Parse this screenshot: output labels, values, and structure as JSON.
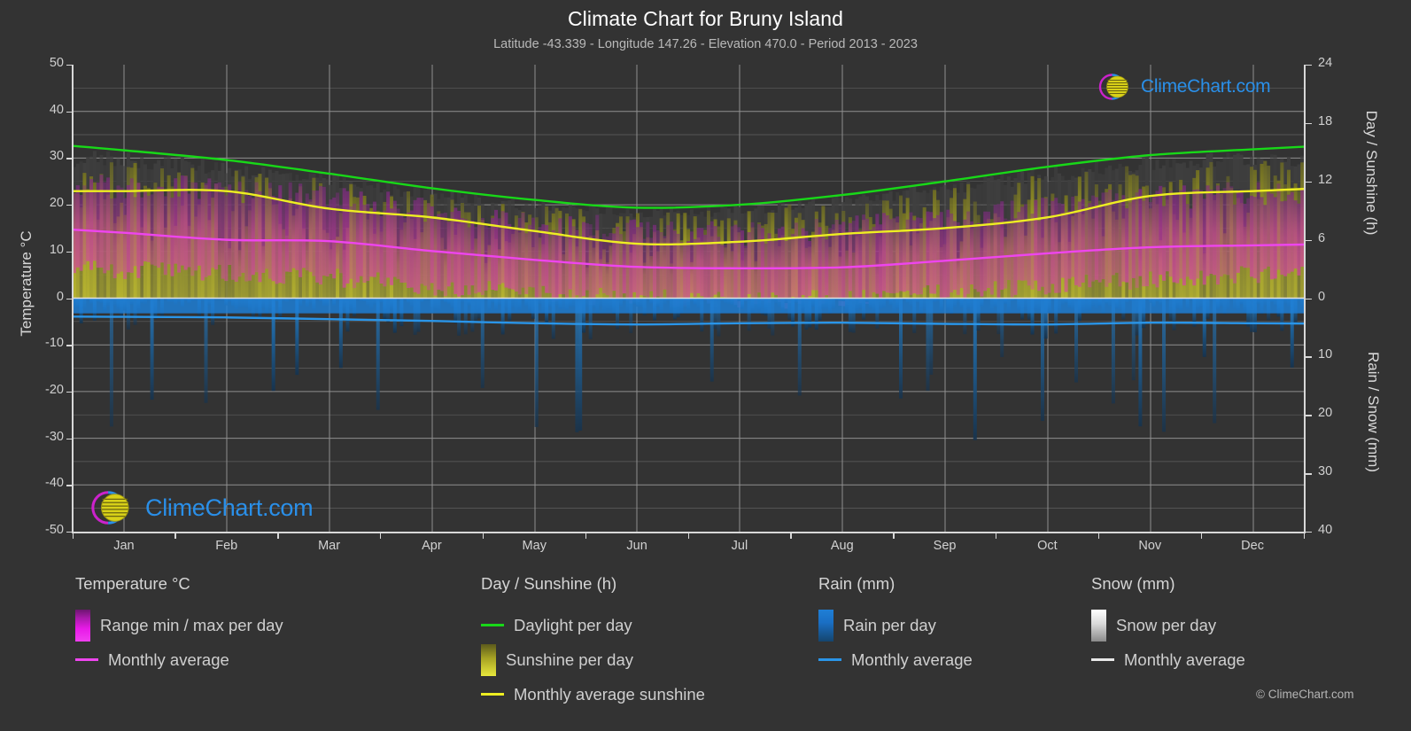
{
  "header": {
    "title": "Climate Chart for Bruny Island",
    "subtitle": "Latitude -43.339 - Longitude 147.26 - Elevation 470.0 - Period 2013 - 2023"
  },
  "branding": {
    "logo_text": "ClimeChart.com",
    "copyright": "© ClimeChart.com",
    "logo_text_color": "#2a8fe8"
  },
  "axes": {
    "left_title": "Temperature °C",
    "right_top_title": "Day / Sunshine (h)",
    "right_bottom_title": "Rain / Snow (mm)",
    "left_ticks": [
      "50",
      "40",
      "30",
      "20",
      "10",
      "0",
      "-10",
      "-20",
      "-30",
      "-40",
      "-50"
    ],
    "right_top_ticks": [
      "24",
      "18",
      "12",
      "6",
      "0"
    ],
    "right_bottom_ticks": [
      "10",
      "20",
      "30",
      "40"
    ]
  },
  "legend": {
    "temperature": {
      "heading": "Temperature °C",
      "items": [
        {
          "label": "Range min / max per day",
          "marker": "gradient-swatch",
          "color": "#e81ae8"
        },
        {
          "label": "Monthly average",
          "marker": "line",
          "color": "#ee45ee"
        }
      ]
    },
    "day_sunshine": {
      "heading": "Day / Sunshine (h)",
      "items": [
        {
          "label": "Daylight per day",
          "marker": "line",
          "color": "#18d818"
        },
        {
          "label": "Sunshine per day",
          "marker": "gradient-swatch",
          "color": "#e8e83c"
        },
        {
          "label": "Monthly average sunshine",
          "marker": "line",
          "color": "#eeee22"
        }
      ]
    },
    "rain": {
      "heading": "Rain (mm)",
      "items": [
        {
          "label": "Rain per day",
          "marker": "gradient-swatch",
          "color": "#1f7fd6"
        },
        {
          "label": "Monthly average",
          "marker": "line",
          "color": "#2a95e8"
        }
      ]
    },
    "snow": {
      "heading": "Snow (mm)",
      "items": [
        {
          "label": "Snow per day",
          "marker": "gradient-swatch",
          "color": "#d8d8d8"
        },
        {
          "label": "Monthly average",
          "marker": "line",
          "color": "#e8e8e8"
        }
      ]
    }
  },
  "chart_data": {
    "type": "line",
    "title": "Climate Chart for Bruny Island",
    "subtitle": "Latitude -43.339 - Longitude 147.26 - Elevation 470.0 - Period 2013 - 2023",
    "xlabel": "",
    "ylabel": "Temperature °C",
    "y2label_top": "Day / Sunshine (h)",
    "y2label_bottom": "Rain / Snow (mm)",
    "ylim": [
      -50,
      50
    ],
    "y2lim_hours": [
      0,
      24
    ],
    "y2lim_mm": [
      0,
      40
    ],
    "grid": true,
    "legend_position": "below",
    "categories": [
      "Jan",
      "Feb",
      "Mar",
      "Apr",
      "May",
      "Jun",
      "Jul",
      "Aug",
      "Sep",
      "Oct",
      "Nov",
      "Dec"
    ],
    "series": [
      {
        "name": "Daylight per day",
        "unit": "h",
        "axis": "right-hours",
        "color": "#18d818",
        "values": [
          15.2,
          14.2,
          12.8,
          11.3,
          10.1,
          9.3,
          9.6,
          10.6,
          12.0,
          13.5,
          14.7,
          15.3
        ]
      },
      {
        "name": "Monthly average sunshine",
        "unit": "h",
        "axis": "right-hours",
        "color": "#eeee22",
        "values": [
          11.0,
          11.0,
          9.2,
          8.3,
          6.9,
          5.6,
          5.8,
          6.6,
          7.2,
          8.3,
          10.5,
          11.0
        ]
      },
      {
        "name": "Temperature monthly average",
        "unit": "°C",
        "axis": "left-temp",
        "color": "#ee45ee",
        "values": [
          14.0,
          12.5,
          12.2,
          10.1,
          8.2,
          6.7,
          6.4,
          6.6,
          8.0,
          9.6,
          10.9,
          11.3
        ]
      },
      {
        "name": "Rain monthly average",
        "unit": "mm",
        "axis": "right-mm",
        "color": "#2a95e8",
        "values": [
          3.2,
          3.3,
          3.6,
          3.9,
          4.3,
          4.5,
          4.3,
          4.2,
          4.4,
          4.5,
          4.2,
          4.3
        ]
      }
    ],
    "daily_bands": [
      {
        "name": "Temperature range min / max per day",
        "axis": "left-temp",
        "color": "#e81ae8",
        "monthly_max": [
          23.0,
          22.5,
          21.0,
          18.0,
          15.5,
          13.5,
          13.0,
          14.0,
          16.0,
          18.5,
          20.5,
          21.5
        ],
        "monthly_min": [
          6.0,
          5.5,
          4.5,
          2.5,
          1.0,
          0.0,
          -0.5,
          0.0,
          1.0,
          2.5,
          4.0,
          5.0
        ]
      },
      {
        "name": "Sunshine per day",
        "axis": "right-hours",
        "color": "#e8e83c",
        "monthly_peak": [
          14.0,
          13.4,
          12.2,
          10.8,
          9.6,
          8.9,
          9.2,
          10.1,
          11.5,
          12.8,
          13.9,
          14.3
        ]
      },
      {
        "name": "Rain per day",
        "axis": "right-mm",
        "color": "#1f7fd6",
        "monthly_peak": [
          22.0,
          20.0,
          24.0,
          26.0,
          28.0,
          30.0,
          28.0,
          26.0,
          27.0,
          29.0,
          25.0,
          24.0
        ]
      },
      {
        "name": "Snow per day",
        "axis": "right-mm",
        "color": "#d8d8d8",
        "monthly_peak": [
          0.0,
          0.0,
          0.0,
          0.0,
          0.0,
          0.0,
          0.0,
          0.0,
          0.0,
          0.0,
          0.0,
          0.0
        ]
      }
    ]
  }
}
